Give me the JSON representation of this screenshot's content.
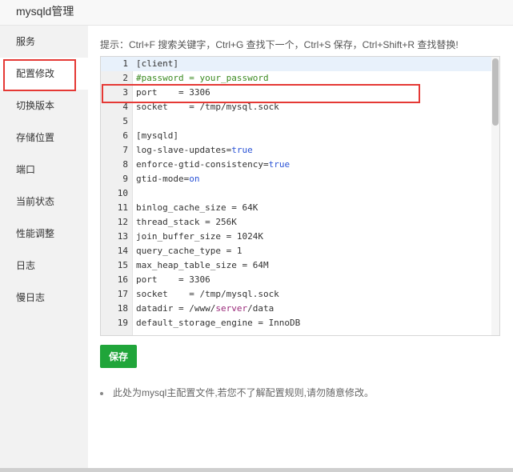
{
  "window": {
    "title": "mysqld管理"
  },
  "sidebar": {
    "items": [
      {
        "label": "服务"
      },
      {
        "label": "配置修改"
      },
      {
        "label": "切换版本"
      },
      {
        "label": "存储位置"
      },
      {
        "label": "端口"
      },
      {
        "label": "当前状态"
      },
      {
        "label": "性能调整"
      },
      {
        "label": "日志"
      },
      {
        "label": "慢日志"
      }
    ]
  },
  "hint": "提示：Ctrl+F 搜索关键字，Ctrl+G 查找下一个，Ctrl+S 保存，Ctrl+Shift+R 查找替换!",
  "editor": {
    "lines": [
      {
        "n": "1",
        "text": "[client]"
      },
      {
        "n": "2",
        "text": "#password = your_password"
      },
      {
        "n": "3",
        "text": "port    = 3306"
      },
      {
        "n": "4",
        "text": "socket    = /tmp/mysql.sock"
      },
      {
        "n": "5",
        "text": ""
      },
      {
        "n": "6",
        "text": "[mysqld]"
      },
      {
        "n": "7",
        "text": "log-slave-updates=true"
      },
      {
        "n": "8",
        "text": "enforce-gtid-consistency=true"
      },
      {
        "n": "9",
        "text": "gtid-mode=on"
      },
      {
        "n": "10",
        "text": ""
      },
      {
        "n": "11",
        "text": "binlog_cache_size = 64K"
      },
      {
        "n": "12",
        "text": "thread_stack = 256K"
      },
      {
        "n": "13",
        "text": "join_buffer_size = 1024K"
      },
      {
        "n": "14",
        "text": "query_cache_type = 1"
      },
      {
        "n": "15",
        "text": "max_heap_table_size = 64M"
      },
      {
        "n": "16",
        "text": "port    = 3306"
      },
      {
        "n": "17",
        "text": "socket    = /tmp/mysql.sock"
      },
      {
        "n": "18",
        "text": "datadir = /www/server/data"
      },
      {
        "n": "19",
        "text": "default_storage_engine = InnoDB"
      }
    ]
  },
  "buttons": {
    "save": "保存"
  },
  "note": "此处为mysql主配置文件,若您不了解配置规则,请勿随意修改。"
}
